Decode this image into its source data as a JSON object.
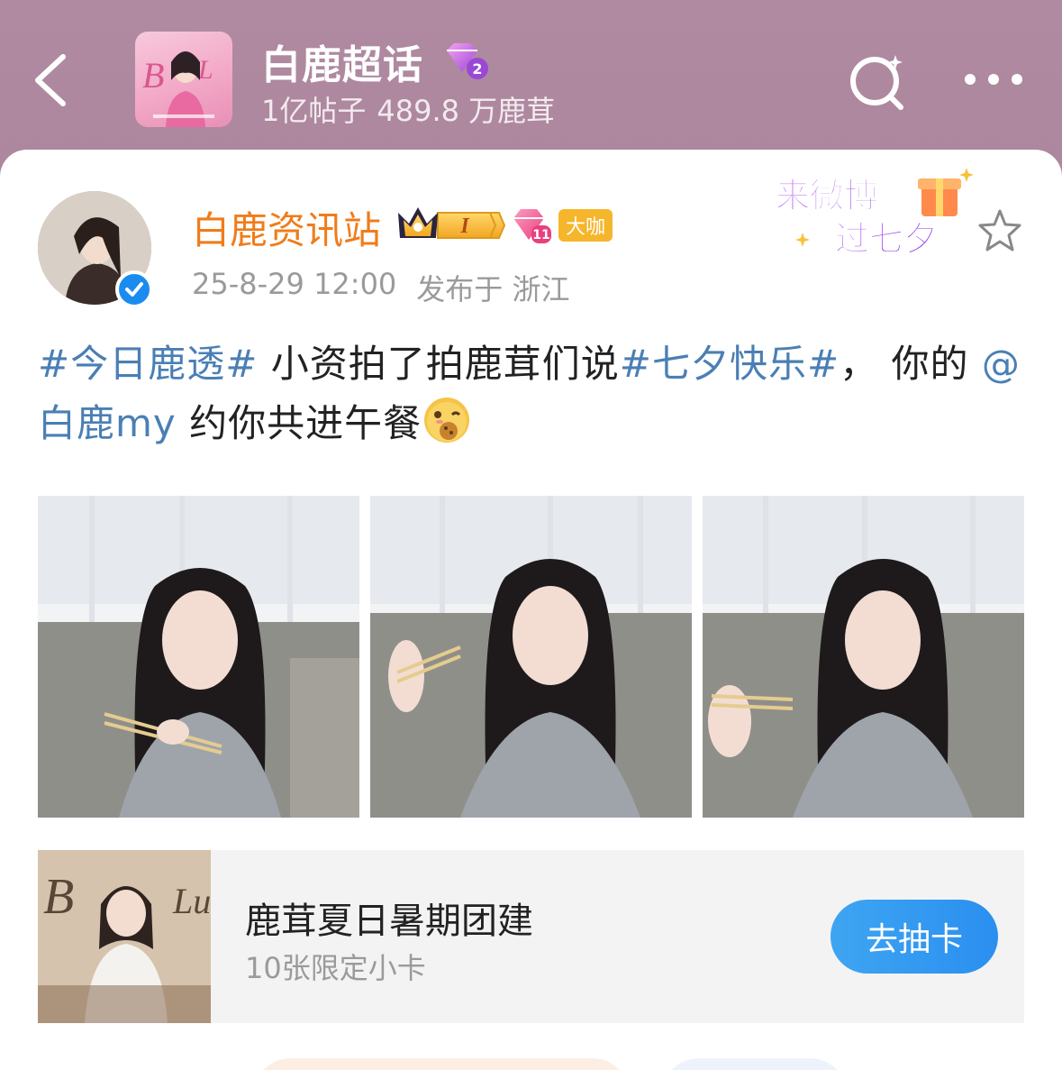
{
  "header": {
    "topic_title": "白鹿超话",
    "topic_level": "2",
    "posts_count": "1亿帖子",
    "fans_count": "489.8 万鹿茸"
  },
  "post": {
    "author": "白鹿资讯站",
    "rank_badge": "I",
    "gem_level": "11",
    "daka_label": "大咖",
    "date": "25-8-29 12:00",
    "location": "发布于 浙江",
    "sticker_line1": "来微博",
    "sticker_line2": "过七夕",
    "text": {
      "tag1": "#今日鹿透#",
      "part1": " 小资拍了拍鹿茸们说",
      "tag2": "#七夕快乐#",
      "part2": "， 你的",
      "mention": "@白鹿my",
      "part3": " 约你共进午餐"
    }
  },
  "link_card": {
    "title": "鹿茸夏日暑期团建",
    "subtitle": "10张限定小卡",
    "button": "去抽卡"
  },
  "colors": {
    "accent_blue": "#2a8ff0",
    "author_orange": "#f07c1a",
    "link_blue": "#4a7fb5"
  }
}
